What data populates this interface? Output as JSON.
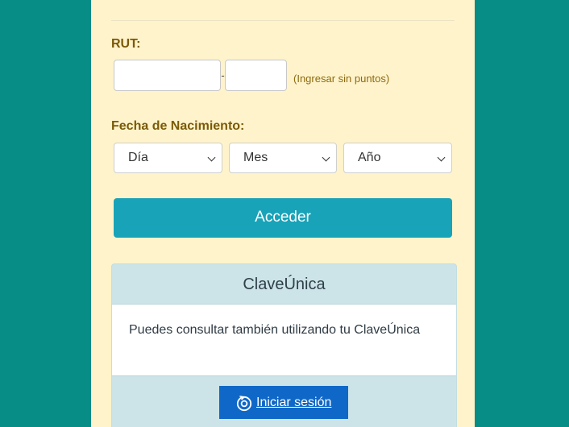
{
  "form": {
    "rut_label": "RUT:",
    "rut_dash": "-",
    "rut_hint": "(Ingresar sin puntos)",
    "rut_value": "",
    "rut_dv_value": "",
    "dob_label": "Fecha de Nacimiento:",
    "day_select": "Día",
    "month_select": "Mes",
    "year_select": "Año",
    "submit_label": "Acceder"
  },
  "clave_unica": {
    "title": "ClaveÚnica",
    "description": "Puedes consultar también utilizando tu ClaveÚnica",
    "login_label": "Iniciar sesión",
    "login_icon": "clave-unica-logo-icon"
  },
  "colors": {
    "background": "#088c86",
    "panel": "#fff3cb",
    "label": "#7a5a07",
    "submit_button": "#18a3b9",
    "login_button": "#0f68c8",
    "card_header": "#cce4e7"
  }
}
